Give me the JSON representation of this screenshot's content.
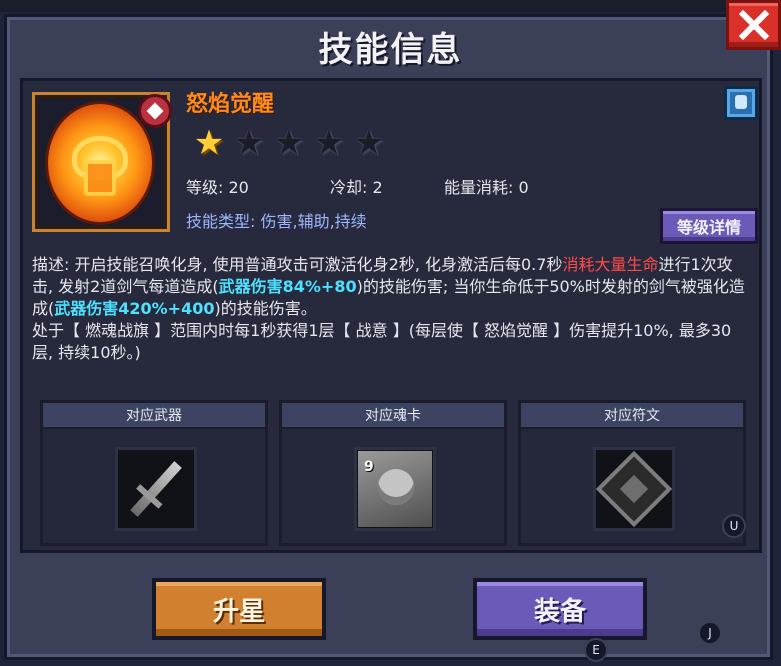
{
  "dialog": {
    "title": "技能信息"
  },
  "skill": {
    "name": "怒焰觉醒",
    "stars": 1,
    "max_stars": 5,
    "level_label": "等级: 20",
    "cooldown_label": "冷却: 2",
    "energy_label": "能量消耗: 0",
    "type_label": "技能类型: 伤害,辅助,持续",
    "level_detail_button": "等级详情"
  },
  "description": {
    "p1": "描述: 开启技能召唤化身, 使用普通攻击可激活化身2秒, 化身激活后每0.7秒",
    "p2_red": "消耗大量生命",
    "p3": "进行1次攻击, 发射2道剑气每道造成(",
    "p4_cyan": "武器伤害84%+80",
    "p5": ")的技能伤害; 当你生命低于50%时发射的剑气被强化造成(",
    "p6_cyan": "武器伤害420%+400",
    "p7": ")的技能伤害。",
    "p8": "处于【 燃魂战旗 】范围内时每1秒获得1层【 战意 】(每层使【 怒焰觉醒 】伤害提升10%, 最多30层, 持续10秒。)"
  },
  "slots": {
    "weapon_label": "对应武器",
    "card_label": "对应魂卡",
    "card_level": "9",
    "rune_label": "对应符文"
  },
  "hotkeys": {
    "u": "U",
    "e": "E",
    "j": "J"
  },
  "actions": {
    "upgrade": "升星",
    "equip": "装备"
  },
  "colors": {
    "accent_orange": "#ff8a1c",
    "cost_red": "#ff4a4a",
    "damage_cyan": "#4ee0ff",
    "type_blue": "#9db6ff"
  }
}
